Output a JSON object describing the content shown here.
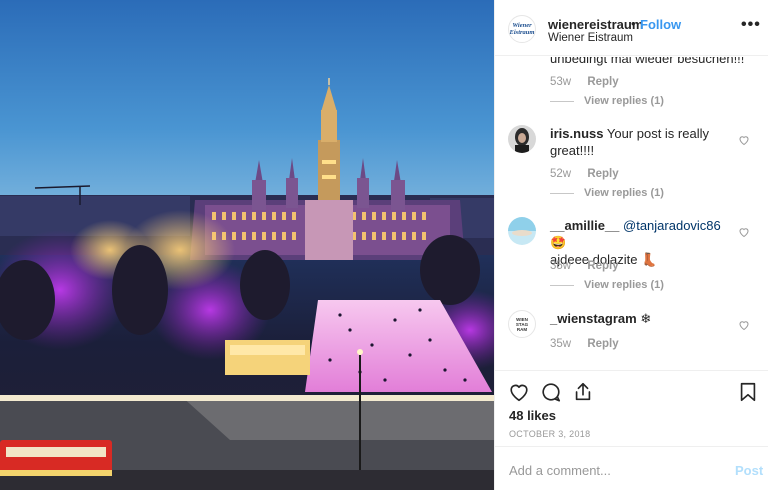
{
  "post": {
    "image_alt": "Vienna City Hall illuminated at night above the Wiener Eistraum ice rink",
    "header": {
      "avatar_line1": "Wiener",
      "avatar_line2": "Eistraum",
      "username": "wienereistraum",
      "separator": "•",
      "follow_label": "Follow",
      "location": "Wiener Eistraum",
      "more_label": "•••"
    },
    "comments_area": {
      "cut_text": "unbedingt mal wieder besuchen!!!",
      "first_meta": {
        "age": "53w",
        "reply": "Reply"
      },
      "first_view_replies": "View replies (1)",
      "items": [
        {
          "username": "iris.nuss",
          "text": "Your post is really great!!!!",
          "age": "52w",
          "reply": "Reply",
          "view_replies": "View replies (1)"
        },
        {
          "username": "__amillie__",
          "mention": "@tanjaradovic86",
          "text_after_mention": "🤩",
          "text_line2": "ajdeee dolazite 👢",
          "age": "35w",
          "reply": "Reply",
          "view_replies": "View replies (1)"
        },
        {
          "username": "_wienstagram",
          "text": "❄",
          "avatar_lines": [
            "WIEN",
            "STAG",
            "RAM"
          ],
          "age": "35w",
          "reply": "Reply"
        }
      ]
    },
    "actions": {
      "likes": "48 likes",
      "date": "OCTOBER 3, 2018",
      "icons": [
        "heart-icon",
        "comment-icon",
        "share-icon",
        "bookmark-icon"
      ]
    },
    "add_comment": {
      "placeholder": "Add a comment...",
      "post_label": "Post"
    },
    "colors": {
      "follow": "#3897f0",
      "mention": "#003569",
      "post_disabled": "#b2dffc",
      "muted": "#999999"
    }
  }
}
